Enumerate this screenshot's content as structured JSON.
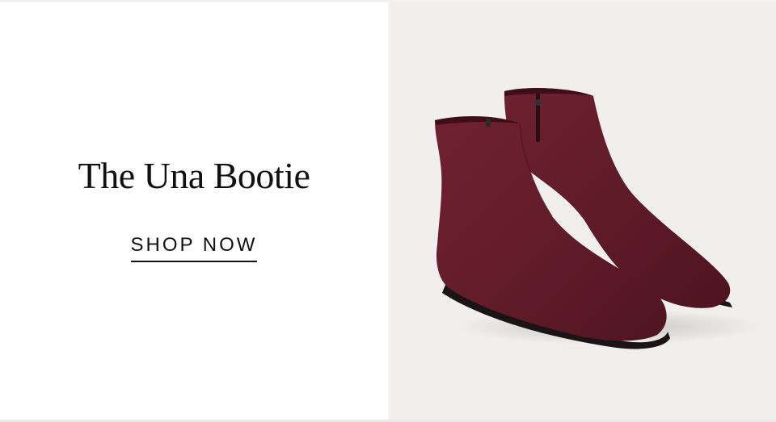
{
  "hero": {
    "title": "The Una Bootie",
    "cta_label": "SHOP NOW",
    "product_color": "#6b1e2b"
  }
}
